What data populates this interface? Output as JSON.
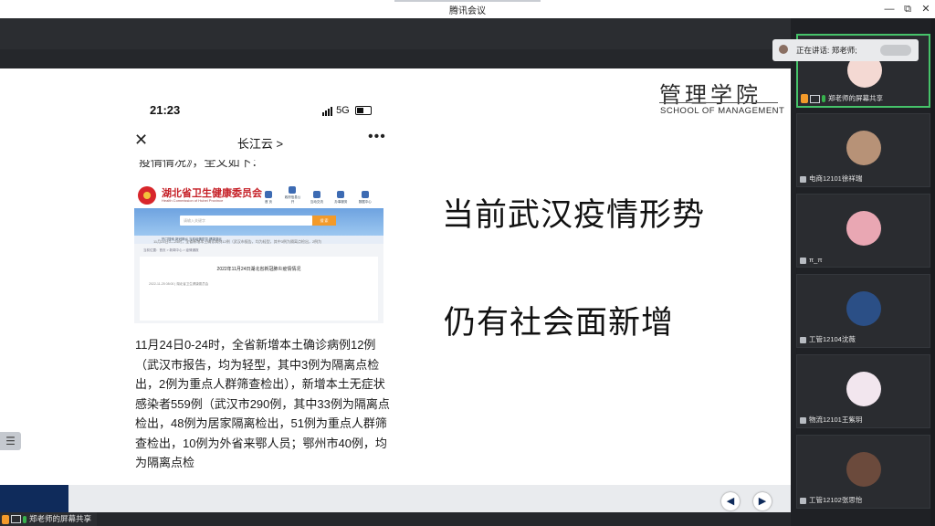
{
  "window": {
    "title": "腾讯会议",
    "controls": {
      "minimize": "—",
      "restore": "⧉",
      "close": "✕"
    }
  },
  "slide": {
    "logo_cn": "管理学院",
    "logo_en": "SCHOOL OF MANAGEMENT",
    "headline_1": "当前武汉疫情形势",
    "headline_2": "仍有社会面新增",
    "phone": {
      "time": "21:23",
      "network": "5G",
      "nav_close": "✕",
      "nav_title": "长江云 >",
      "nav_more": "•••",
      "cut_line": "疫情情况》，全文如下：",
      "webpage": {
        "site_name": "湖北省卫生健康委员会",
        "site_sub": "Health Commission of Hubei Province",
        "menu": [
          "首 页",
          "政府信息公开",
          "互动交流",
          "办事服务",
          "数据中心"
        ],
        "search_placeholder": "请输入关键字",
        "search_button": "搜 索",
        "tabs": "热门搜索   新冠肺炎   当前疫情防控   健康湖北",
        "breadcrumb": "当前位置：首页 > 新闻中心 > 疫情通报",
        "headline": "2022年11月24日湖北省新冠肺炎疫情情况",
        "meta": "2022-11-25 08:00  |  湖北省卫生健康委员会",
        "body_line": "11月24日0—24时，全省新增本土确诊病例12例（武汉市报告，均为轻型，其中3例为隔离点检出，2例为"
      },
      "article": "11月24日0-24时，全省新增本土确诊病例12例（武汉市报告，均为轻型，其中3例为隔离点检出，2例为重点人群筛查检出），新增本土无症状感染者559例（武汉市290例，其中33例为隔离点检出，48例为居家隔离检出，51例为重点人群筛查检出，10例为外省来鄂人员；鄂州市40例，均为隔离点检"
    },
    "prev_icon": "◀",
    "next_icon": "▶",
    "menu_icon": "☰"
  },
  "share_bar": {
    "label": "郑老师的屏幕共享"
  },
  "speaker_tip": {
    "label": "正在讲话: 郑老师;"
  },
  "participants": [
    {
      "name": "郑老师的屏幕共享",
      "avatar_color": "#f4d9d3",
      "active": true
    },
    {
      "name": "电商12101徐祥瑞",
      "avatar_color": "#b79277",
      "active": false
    },
    {
      "name": "π_π",
      "avatar_color": "#e9a7b3",
      "active": false
    },
    {
      "name": "工管12104沈薇",
      "avatar_color": "#2b4f86",
      "active": false
    },
    {
      "name": "物流12101王紫玥",
      "avatar_color": "#f2e6ee",
      "active": false
    },
    {
      "name": "工管12102张思怡",
      "avatar_color": "#6b4a3c",
      "active": false
    }
  ]
}
